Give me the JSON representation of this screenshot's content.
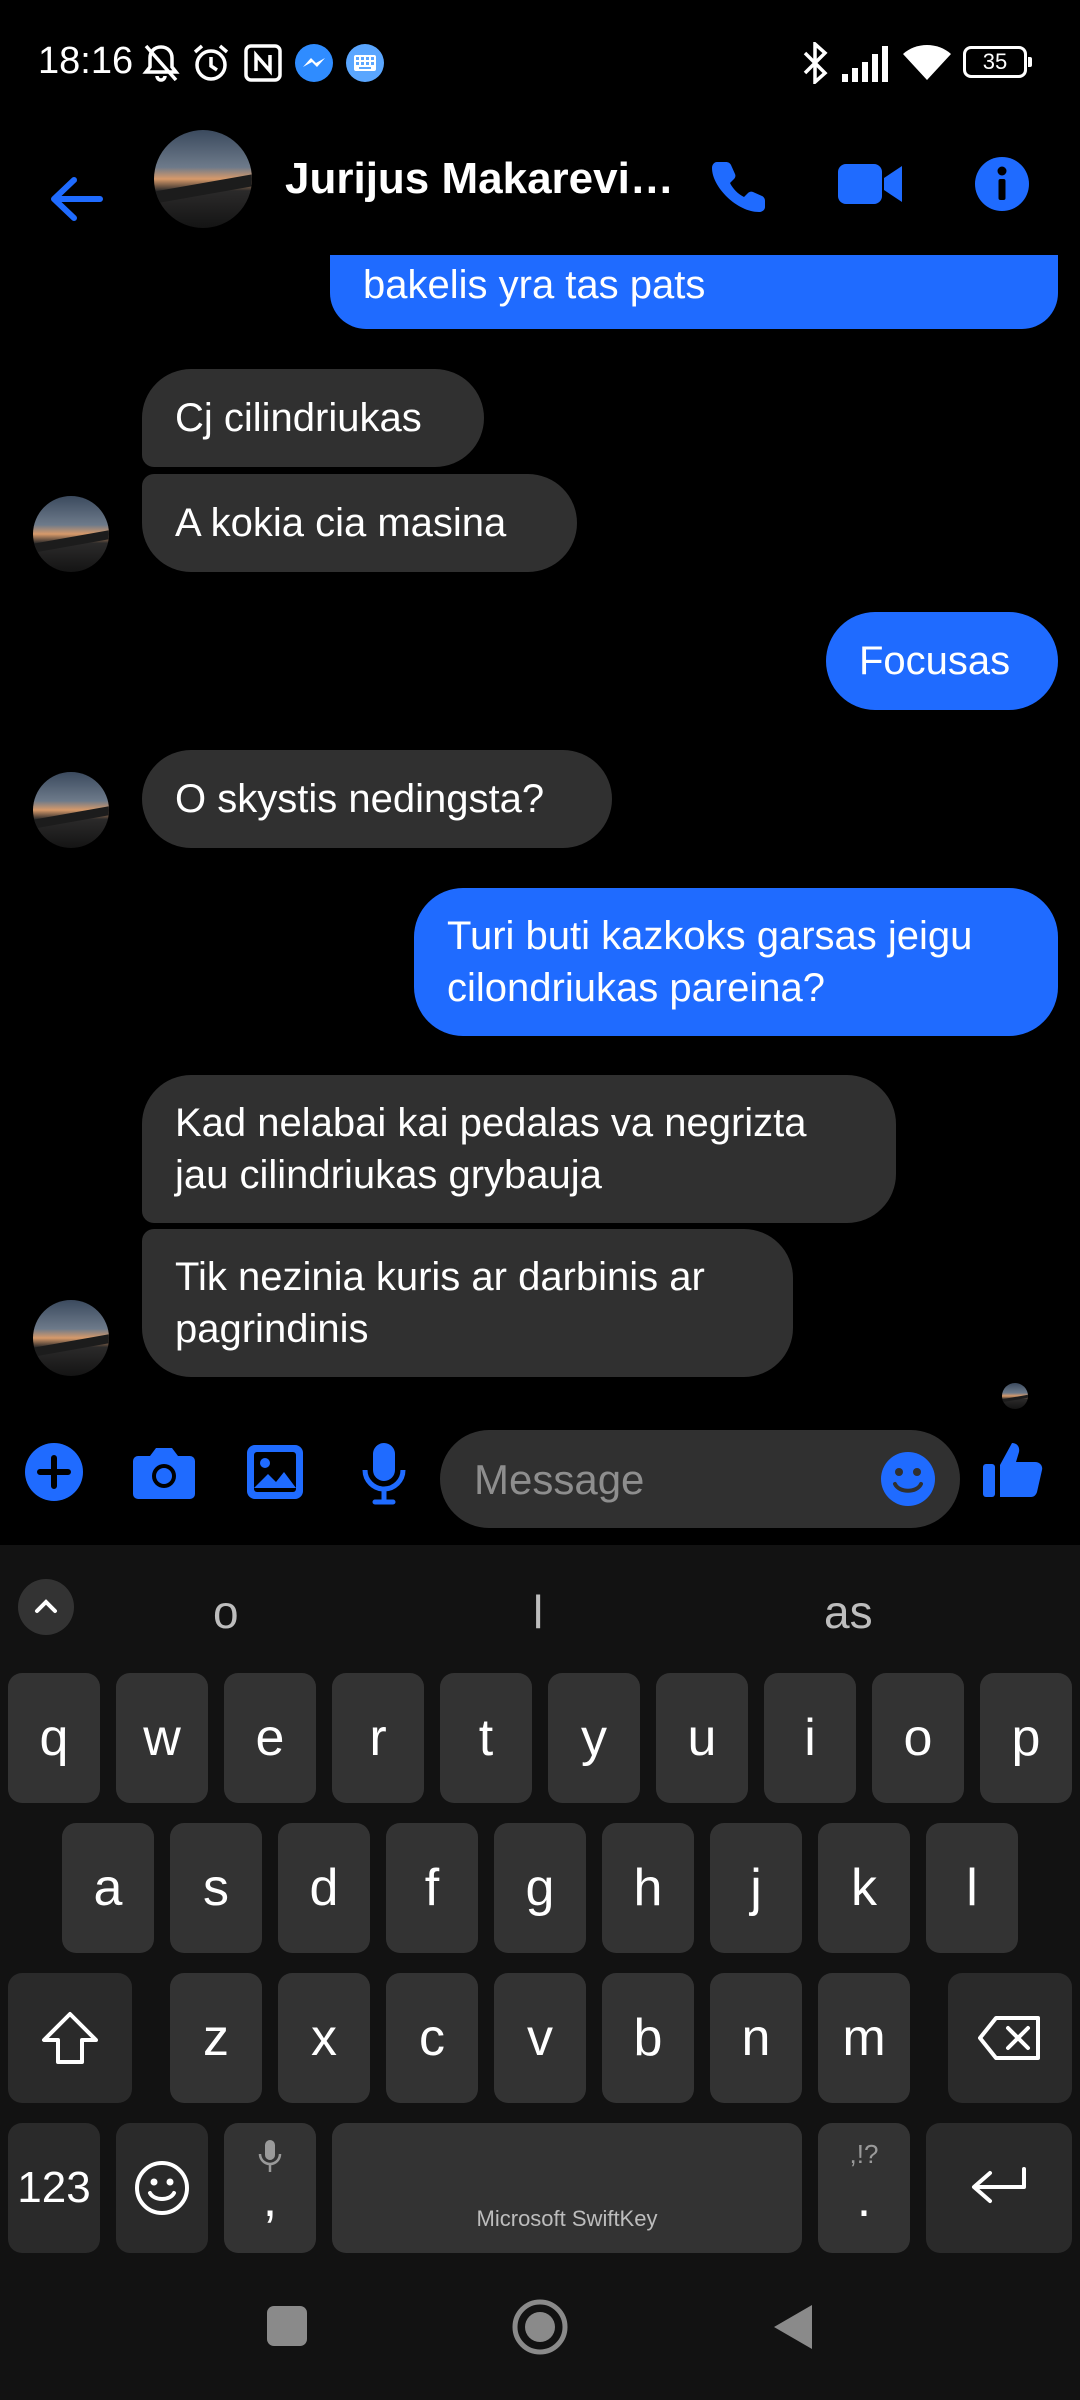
{
  "status_bar": {
    "time": "18:16",
    "battery": "35",
    "left_icons": [
      "muted-bell-icon",
      "alarm-icon",
      "nfc-icon",
      "messenger-icon",
      "keyboard-icon"
    ],
    "right_icons": [
      "bluetooth-icon",
      "signal-icon",
      "wifi-icon",
      "battery-icon"
    ]
  },
  "header": {
    "contact_name": "Jurijus Makarevič…",
    "icons": [
      "back-arrow-icon",
      "phone-icon",
      "video-icon",
      "info-icon"
    ]
  },
  "messages": [
    {
      "side": "out",
      "text": "bakelis yra tas pats"
    },
    {
      "side": "in",
      "text": "Cj cilindriukas"
    },
    {
      "side": "in",
      "text": "A kokia cia masina"
    },
    {
      "side": "out",
      "text": "Focusas"
    },
    {
      "side": "in",
      "text": "O skystis nedingsta?"
    },
    {
      "side": "out",
      "line1": "Turi buti kazkoks garsas jeigu",
      "line2": "cilondriukas pareina?"
    },
    {
      "side": "in",
      "line1": "Kad nelabai kai pedalas va negrizta",
      "line2": "jau cilindriukas grybauja"
    },
    {
      "side": "in",
      "line1": "Tik nezinia kuris ar darbinis ar",
      "line2": "pagrindinis"
    }
  ],
  "composer": {
    "placeholder": "Message",
    "icons": [
      "add-icon",
      "camera-icon",
      "gallery-icon",
      "microphone-icon",
      "emoji-icon",
      "thumbs-up-icon"
    ]
  },
  "keyboard": {
    "suggestions": [
      "o",
      "l",
      "as"
    ],
    "row1": [
      "q",
      "w",
      "e",
      "r",
      "t",
      "y",
      "u",
      "i",
      "o",
      "p"
    ],
    "row2": [
      "a",
      "s",
      "d",
      "f",
      "g",
      "h",
      "j",
      "k",
      "l"
    ],
    "row3": [
      "z",
      "x",
      "c",
      "v",
      "b",
      "n",
      "m"
    ],
    "numbers_key": "123",
    "comma_key": ",",
    "period_key": ".",
    "period_hint": ",!?",
    "space_label": "Microsoft SwiftKey"
  },
  "colors": {
    "accent": "#1f6bff",
    "incoming_bubble": "#303030",
    "background": "#000000"
  }
}
